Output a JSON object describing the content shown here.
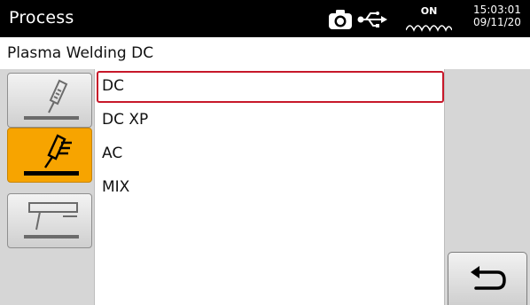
{
  "header": {
    "title": "Process",
    "icons": [
      "camera-icon",
      "usb-icon"
    ],
    "on_indicator": "ON",
    "time": "15:03:01",
    "date": "09/11/20"
  },
  "subtitle": "Plasma Welding  DC",
  "sidebar": {
    "tabs": [
      {
        "icon": "torch-icon",
        "active": false
      },
      {
        "icon": "torch-icon",
        "active": true
      },
      {
        "icon": "trigger-mode-icon",
        "active": false
      }
    ]
  },
  "list": {
    "items": [
      "DC",
      "DC XP",
      "AC",
      "MIX"
    ],
    "selected_index": 0
  },
  "actions": {
    "back_icon": "back-arrow-icon"
  },
  "colors": {
    "active_tab": "#f7a400",
    "selection_border": "#c7182a",
    "header_bg": "#000000"
  }
}
